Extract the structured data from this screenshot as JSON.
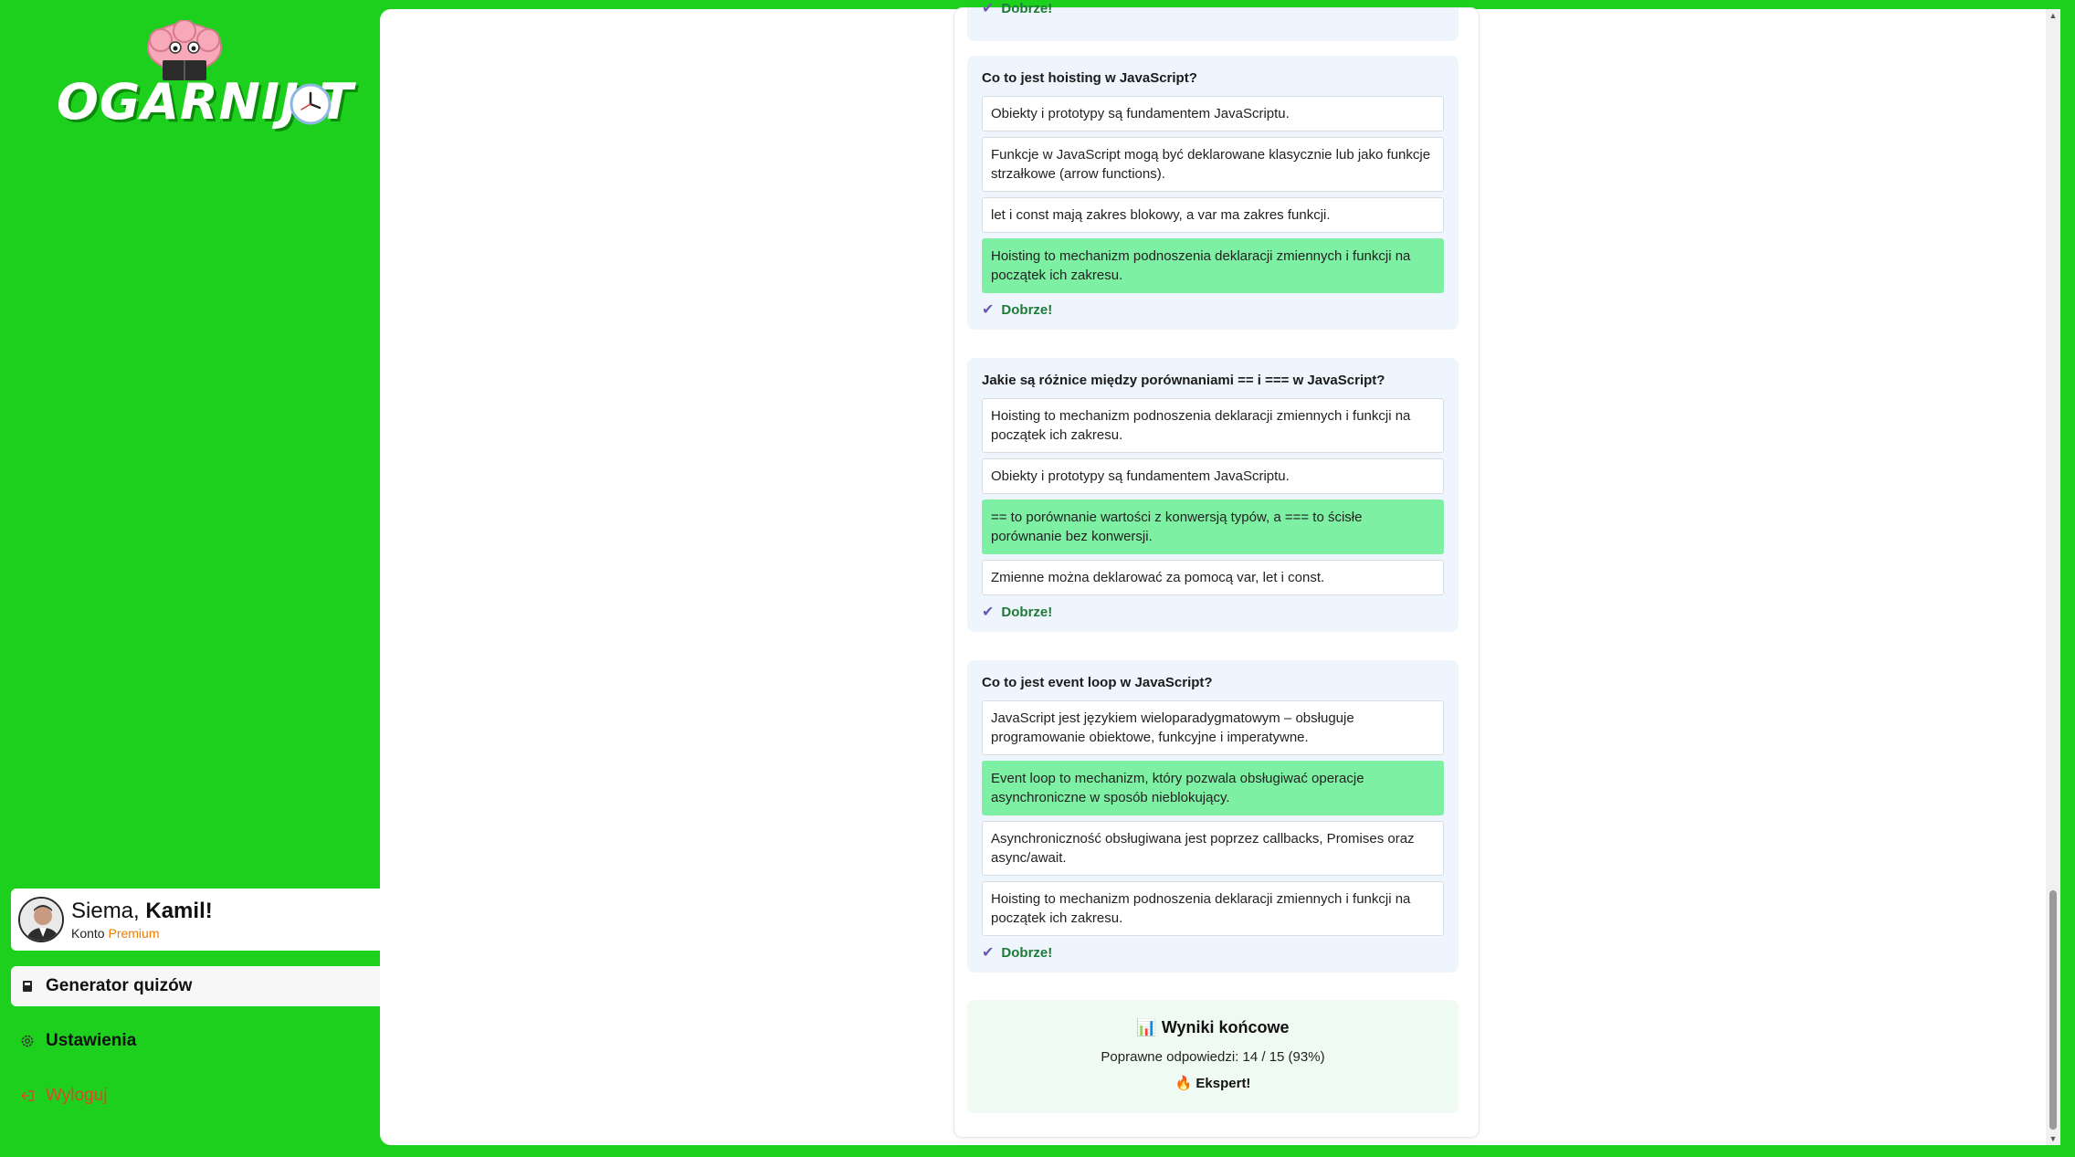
{
  "brand": {
    "logo_text": "OGARNIJ.T"
  },
  "user": {
    "greeting_prefix": "Siema, ",
    "name": "Kamil!",
    "account_prefix": "Konto ",
    "account_type": "Premium"
  },
  "nav": {
    "generator": "Generator quizów",
    "settings": "Ustawienia",
    "logout": "Wyloguj"
  },
  "quiz": {
    "top_feedback": "Dobrze!",
    "questions": [
      {
        "title": "Co to jest hoisting w JavaScript?",
        "answers": [
          "Obiekty i prototypy są fundamentem JavaScriptu.",
          "Funkcje w JavaScript mogą być deklarowane klasycznie lub jako funkcje strzałkowe (arrow functions).",
          "let i const mają zakres blokowy, a var ma zakres funkcji.",
          "Hoisting to mechanizm podnoszenia deklaracji zmiennych i funkcji na początek ich zakresu."
        ],
        "correct_index": 3,
        "feedback": "Dobrze!"
      },
      {
        "title": "Jakie są różnice między porównaniami == i === w JavaScript?",
        "answers": [
          "Hoisting to mechanizm podnoszenia deklaracji zmiennych i funkcji na początek ich zakresu.",
          "Obiekty i prototypy są fundamentem JavaScriptu.",
          "== to porównanie wartości z konwersją typów, a === to ścisłe porównanie bez konwersji.",
          "Zmienne można deklarować za pomocą var, let i const."
        ],
        "correct_index": 2,
        "feedback": "Dobrze!"
      },
      {
        "title": "Co to jest event loop w JavaScript?",
        "answers": [
          "JavaScript jest językiem wieloparadygmatowym – obsługuje programowanie obiektowe, funkcyjne i imperatywne.",
          "Event loop to mechanizm, który pozwala obsługiwać operacje asynchroniczne w sposób nieblokujący.",
          "Asynchroniczność obsługiwana jest poprzez callbacks, Promises oraz async/await.",
          "Hoisting to mechanizm podnoszenia deklaracji zmiennych i funkcji na początek ich zakresu."
        ],
        "correct_index": 1,
        "feedback": "Dobrze!"
      }
    ]
  },
  "results": {
    "icon": "📊",
    "title": "Wyniki końcowe",
    "score_line": "Poprawne odpowiedzi: 14 / 15 (93%)",
    "badge_icon": "🔥",
    "badge": "Ekspert!"
  },
  "colors": {
    "background": "#1ed01e",
    "correct": "#7ef0a3",
    "card": "#eef5fd",
    "premium": "#f07b00",
    "logout": "#e0442a"
  }
}
